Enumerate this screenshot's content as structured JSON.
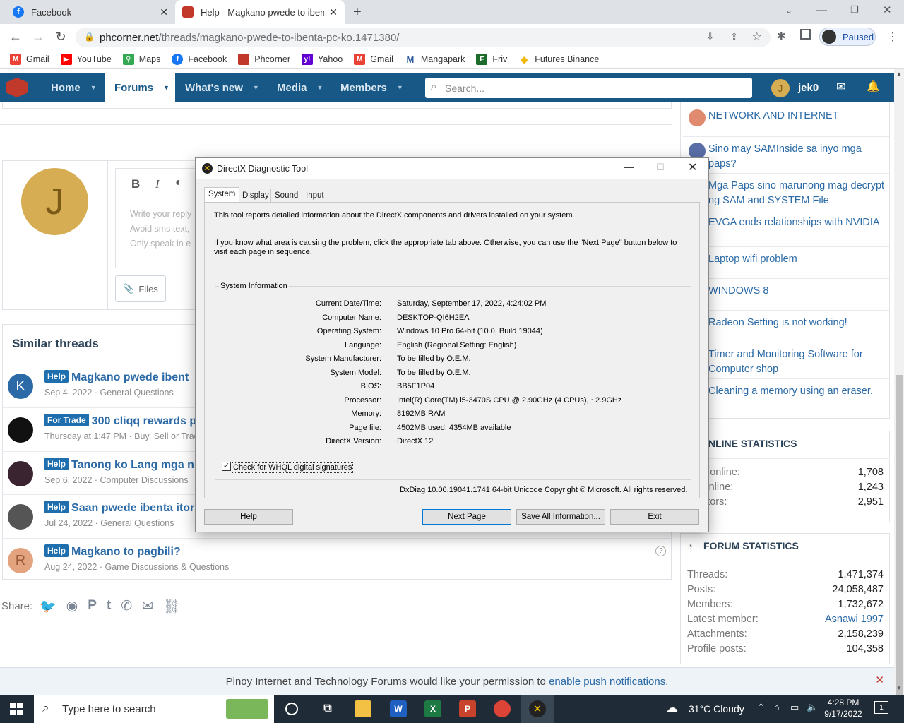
{
  "browser": {
    "tabs": [
      {
        "title": "Facebook"
      },
      {
        "title": "Help - Magkano pwede to ibenta"
      }
    ],
    "url_host": "phcorner.net",
    "url_path": "/threads/magkano-pwede-to-ibenta-pc-ko.1471380/",
    "profile_status": "Paused",
    "bookmarks": [
      "Gmail",
      "YouTube",
      "Maps",
      "Facebook",
      "Phcorner",
      "Yahoo",
      "Gmail",
      "Mangapark",
      "Friv",
      "Futures Binance"
    ]
  },
  "site_nav": {
    "items": [
      "Home",
      "Forums",
      "What's new",
      "Media",
      "Members"
    ],
    "search_placeholder": "Search...",
    "user_initial": "J",
    "username": "jek0"
  },
  "editor": {
    "avatar_initial": "J",
    "placeholder_lines": [
      "Write your reply",
      "Avoid sms text,",
      "Only speak in e"
    ],
    "files_label": "Files"
  },
  "similar_threads": {
    "heading": "Similar threads",
    "items": [
      {
        "badge": "Help",
        "title": "Magkano pwede ibent",
        "meta": "Sep 4, 2022 · General Questions",
        "avatar_letter": "K",
        "avatar_color": "#2b6aa6"
      },
      {
        "badge": "For Trade",
        "title": "300 cliqq rewards p",
        "meta": "Thursday at 1:47 PM · Buy, Sell or Trad",
        "avatar_letter": "",
        "avatar_color": "#111111"
      },
      {
        "badge": "Help",
        "title": "Tanong ko Lang mga n",
        "meta": "Sep 6, 2022 · Computer Discussions",
        "avatar_letter": "",
        "avatar_color": "#3a2430"
      },
      {
        "badge": "Help",
        "title": "Saan pwede ibenta itor",
        "meta": "Jul 24, 2022 · General Questions",
        "avatar_letter": "",
        "avatar_color": "#555555"
      },
      {
        "badge": "Help",
        "title": "Magkano to pagbili?",
        "meta": "Aug 24, 2022 · Game Discussions & Questions",
        "avatar_letter": "R",
        "avatar_color": "#e2a37e"
      }
    ]
  },
  "share_label": "Share:",
  "sidebar": {
    "threads": [
      "NETWORK AND INTERNET",
      "Sino may SAMInside sa inyo mga paps?",
      "Mga Paps sino marunong mag decrypt ng SAM and SYSTEM File",
      "EVGA ends relationships with NVIDIA",
      "Laptop wifi problem",
      "WINDOWS 8",
      "Radeon Setting is not working!",
      "Timer and Monitoring Software for Computer shop",
      "Cleaning a memory using an eraser."
    ],
    "online_heading": "NLINE STATISTICS",
    "online": [
      {
        "k": "bers online:",
        "v": "1,708"
      },
      {
        "k": "sts online:",
        "v": "1,243"
      },
      {
        "k": "l visitors:",
        "v": "2,951"
      }
    ],
    "forum_heading": "FORUM STATISTICS",
    "forum": [
      {
        "k": "Threads:",
        "v": "1,471,374"
      },
      {
        "k": "Posts:",
        "v": "24,058,487"
      },
      {
        "k": "Members:",
        "v": "1,732,672"
      },
      {
        "k": "Latest member:",
        "v": "Asnawi 1997"
      },
      {
        "k": "Attachments:",
        "v": "2,158,239"
      },
      {
        "k": "Profile posts:",
        "v": "104,358"
      }
    ]
  },
  "dxdiag": {
    "title": "DirectX Diagnostic Tool",
    "tabs": [
      "System",
      "Display",
      "Sound",
      "Input"
    ],
    "intro1": "This tool reports detailed information about the DirectX components and drivers installed on your system.",
    "intro2": "If you know what area is causing the problem, click the appropriate tab above.  Otherwise, you can use the \"Next Page\" button below to visit each page in sequence.",
    "group_label": "System Information",
    "fields": [
      {
        "label": "Current Date/Time:",
        "value": "Saturday, September 17, 2022, 4:24:02 PM"
      },
      {
        "label": "Computer Name:",
        "value": "DESKTOP-QI6H2EA"
      },
      {
        "label": "Operating System:",
        "value": "Windows 10 Pro 64-bit (10.0, Build 19044)"
      },
      {
        "label": "Language:",
        "value": "English (Regional Setting: English)"
      },
      {
        "label": "System Manufacturer:",
        "value": "To be filled by O.E.M."
      },
      {
        "label": "System Model:",
        "value": "To be filled by O.E.M."
      },
      {
        "label": "BIOS:",
        "value": "BB5F1P04"
      },
      {
        "label": "Processor:",
        "value": "Intel(R) Core(TM) i5-3470S CPU @ 2.90GHz (4 CPUs), ~2.9GHz"
      },
      {
        "label": "Memory:",
        "value": "8192MB RAM"
      },
      {
        "label": "Page file:",
        "value": "4502MB used, 4354MB available"
      },
      {
        "label": "DirectX Version:",
        "value": "DirectX 12"
      }
    ],
    "checkbox_label": "Check for WHQL digital signatures",
    "footer": "DxDiag 10.00.19041.1741 64-bit Unicode  Copyright © Microsoft. All rights reserved.",
    "buttons": {
      "help": "Help",
      "next": "Next Page",
      "save": "Save All Information...",
      "exit": "Exit"
    }
  },
  "notification": {
    "text": "Pinoy Internet and Technology Forums would like your permission to ",
    "link": "enable push notifications."
  },
  "taskbar": {
    "search_placeholder": "Type here to search",
    "weather": "31°C  Cloudy",
    "time": "4:28 PM",
    "date": "9/17/2022",
    "notif_count": "1"
  }
}
